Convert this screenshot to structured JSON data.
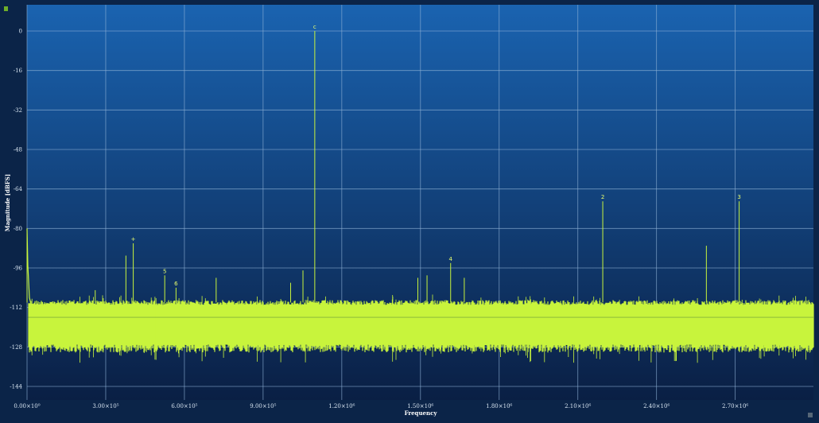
{
  "chart_data": {
    "type": "line",
    "xlabel": "Frequency",
    "ylabel": "Magnitude [dBFS]",
    "xlim": [
      0,
      3000000
    ],
    "ylim": [
      -150,
      10
    ],
    "x_ticks": [
      {
        "value": 0,
        "label": "0.00×10⁰"
      },
      {
        "value": 300000,
        "label": "3.00×10⁵"
      },
      {
        "value": 600000,
        "label": "6.00×10⁵"
      },
      {
        "value": 900000,
        "label": "9.00×10⁵"
      },
      {
        "value": 1200000,
        "label": "1.20×10⁶"
      },
      {
        "value": 1500000,
        "label": "1.50×10⁶"
      },
      {
        "value": 1800000,
        "label": "1.80×10⁶"
      },
      {
        "value": 2100000,
        "label": "2.10×10⁶"
      },
      {
        "value": 2400000,
        "label": "2.40×10⁶"
      },
      {
        "value": 2700000,
        "label": "2.70×10⁶"
      }
    ],
    "y_ticks": [
      0,
      -16,
      -32,
      -48,
      -64,
      -80,
      -96,
      -112,
      -128,
      -144
    ],
    "grid": true,
    "noise_floor": {
      "upper": -110,
      "lower": -128,
      "mean": -116
    },
    "peaks": [
      {
        "x": 1097000,
        "y": 0,
        "marker": "c"
      },
      {
        "x": 2195000,
        "y": -69,
        "marker": "2"
      },
      {
        "x": 2715000,
        "y": -69,
        "marker": "3"
      },
      {
        "x": 1615000,
        "y": -94,
        "marker": "4"
      },
      {
        "x": 525000,
        "y": -99,
        "marker": "5"
      },
      {
        "x": 568000,
        "y": -104,
        "marker": "6"
      },
      {
        "x": 405000,
        "y": -86,
        "marker": "+"
      },
      {
        "x": 377000,
        "y": -91
      },
      {
        "x": 2590000,
        "y": -87
      },
      {
        "x": 1052000,
        "y": -97
      },
      {
        "x": 1490000,
        "y": -100
      },
      {
        "x": 1525000,
        "y": -99
      },
      {
        "x": 1667000,
        "y": -100
      },
      {
        "x": 721000,
        "y": -100
      },
      {
        "x": 1005000,
        "y": -102
      },
      {
        "x": 260000,
        "y": -105
      },
      {
        "x": 0,
        "y": -80
      }
    ],
    "colors": {
      "trace": "#c8f43c",
      "background_top": "#1a63b0",
      "background_bottom": "#0a1f44",
      "grid": "#8fb2d6"
    }
  }
}
